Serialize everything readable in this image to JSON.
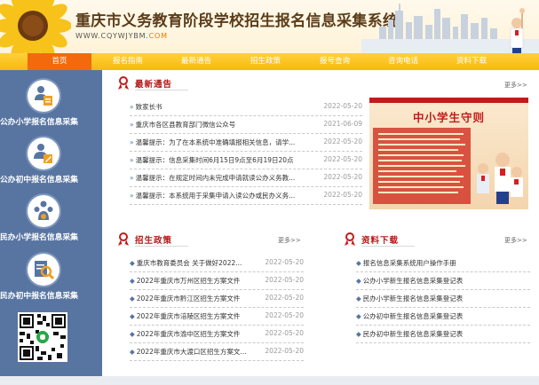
{
  "header": {
    "title": "重庆市义务教育阶段学校招生报名信息采集系统",
    "domain_prefix": "WWW.CQYWJYBM.",
    "domain_suffix": "COM"
  },
  "nav": [
    "首页",
    "报名指南",
    "最新通告",
    "招生政策",
    "报号查询",
    "咨询电话",
    "资料下载"
  ],
  "sidebar": [
    {
      "label": "公办小学报名信息采集",
      "icon": "form-edit-icon"
    },
    {
      "label": "公办初中报名信息采集",
      "icon": "user-edit-icon"
    },
    {
      "label": "民办小学报名信息采集",
      "icon": "group-icon"
    },
    {
      "label": "民办初中报名信息采集",
      "icon": "search-doc-icon"
    }
  ],
  "notices": {
    "title": "最新通告",
    "more": "更多>>",
    "items": [
      {
        "title": "致家长书",
        "date": "2022-05-20"
      },
      {
        "title": "重庆市各区县教育部门微信公众号",
        "date": "2021-06-09"
      },
      {
        "title": "温馨提示：为了在本系统中准确填报相关信息，请学...",
        "date": "2022-05-20"
      },
      {
        "title": "温馨提示：信息采集时间6月15日9点至6月19日20点",
        "date": "2022-05-20"
      },
      {
        "title": "温馨提示：在规定时间内未完成申请就读公办义务教...",
        "date": "2022-05-20"
      },
      {
        "title": "温馨提示：本系统用于采集申请入读公办或民办义务...",
        "date": "2022-05-20"
      }
    ]
  },
  "poster": {
    "title": "中小学生守则"
  },
  "policy": {
    "title": "招生政策",
    "more": "更多>>",
    "items": [
      {
        "title": "重庆市教育委员会 关于做好2022...",
        "date": "2022-05-20"
      },
      {
        "title": "2022年重庆市万州区招生方案文件",
        "date": "2022-05-20"
      },
      {
        "title": "2022年重庆市黔江区招生方案文件",
        "date": "2022-05-20"
      },
      {
        "title": "2022年重庆市涪陵区招生方案文件",
        "date": "2022-05-20"
      },
      {
        "title": "2022年重庆市渝中区招生方案文件",
        "date": "2022-05-20"
      },
      {
        "title": "2022年重庆市大渡口区招生方案文...",
        "date": "2022-05-20"
      }
    ]
  },
  "downloads": {
    "title": "资料下载",
    "more": "更多>>",
    "items": [
      {
        "title": "报名信息采集系统用户操作手册"
      },
      {
        "title": "公办小学新生报名信息采集登记表"
      },
      {
        "title": "民办小学新生报名信息采集登记表"
      },
      {
        "title": "公办初中新生报名信息采集登记表"
      },
      {
        "title": "民办初中新生报名信息采集登记表"
      }
    ]
  },
  "colors": {
    "nav": "#f7b90e",
    "nav_active": "#f26a0c",
    "sidebar": "#5875a2",
    "section_title": "#b51616"
  }
}
